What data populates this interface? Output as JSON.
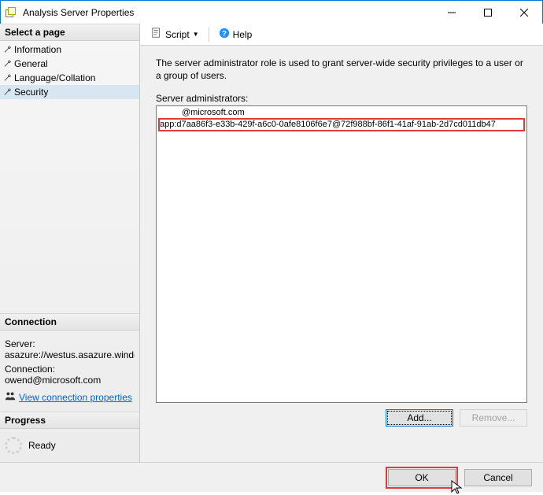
{
  "window": {
    "title": "Analysis Server Properties"
  },
  "sidebar": {
    "select_page_header": "Select a page",
    "pages": [
      {
        "label": "Information"
      },
      {
        "label": "General"
      },
      {
        "label": "Language/Collation"
      },
      {
        "label": "Security"
      }
    ],
    "connection_header": "Connection",
    "server_label": "Server:",
    "server_value": "asazure://westus.asazure.windows",
    "connection_label": "Connection:",
    "connection_value": "owend@microsoft.com",
    "view_connection_link": "View connection properties",
    "progress_header": "Progress",
    "progress_status": "Ready"
  },
  "toolbar": {
    "script_label": "Script",
    "help_label": "Help"
  },
  "main": {
    "description": "The server administrator role is used to grant server-wide security privileges to a user or a group of users.",
    "list_label": "Server administrators:",
    "admins": [
      {
        "text": "@microsoft.com",
        "indented": true,
        "highlight": false
      },
      {
        "text": "app:d7aa86f3-e33b-429f-a6c0-0afe8106f6e7@72f988bf-86f1-41af-91ab-2d7cd011db47",
        "indented": false,
        "highlight": true
      }
    ],
    "add_button": "Add...",
    "remove_button": "Remove..."
  },
  "footer": {
    "ok": "OK",
    "cancel": "Cancel"
  }
}
